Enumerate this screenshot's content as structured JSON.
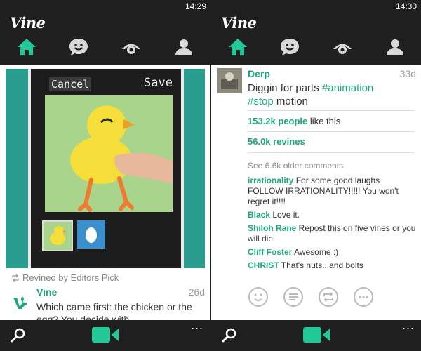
{
  "left": {
    "status_time": "14:29",
    "app_name": "Vine",
    "video": {
      "cancel_label": "Cancel",
      "save_label": "Save"
    },
    "revined_by": "Revined by Editors Pick",
    "post": {
      "author": "Vine",
      "age": "26d",
      "caption": "Which came first: the chicken or the egg? You decide with..."
    },
    "more_label": "..."
  },
  "right": {
    "status_time": "14:30",
    "app_name": "Vine",
    "post": {
      "author": "Derp",
      "age": "33d",
      "caption_text": "Diggin for parts ",
      "tag1": "#animation",
      "tag2": "#stop",
      "caption_end": " motion"
    },
    "likes": {
      "count": "153.2k people",
      "rest": " like this"
    },
    "revines": {
      "count": "56.0k revines"
    },
    "older_comments": "See 6.6k older comments",
    "comments": [
      {
        "name": "irrationality",
        "text": " For some good laughs FOLLOW IRRATIONALITY!!!!! You won't regret it!!!!"
      },
      {
        "name": "Black",
        "text": " Love it."
      },
      {
        "name": "Shiloh Rane",
        "text": " Repost this on five vines or you will die"
      },
      {
        "name": "Cliff Foster",
        "text": " Awesome :)"
      },
      {
        "name": "CHRIST",
        "text": " That's nuts...and bolts"
      }
    ],
    "more_label": "..."
  },
  "icons": {
    "nav": [
      "home-icon",
      "chat-icon",
      "eye-icon",
      "user-icon"
    ],
    "actions": [
      "smiley-icon",
      "comment-icon",
      "revine-icon",
      "more-icon"
    ]
  },
  "colors": {
    "accent": "#1da77f",
    "bar": "#1f1f1f",
    "muted": "#888888"
  }
}
